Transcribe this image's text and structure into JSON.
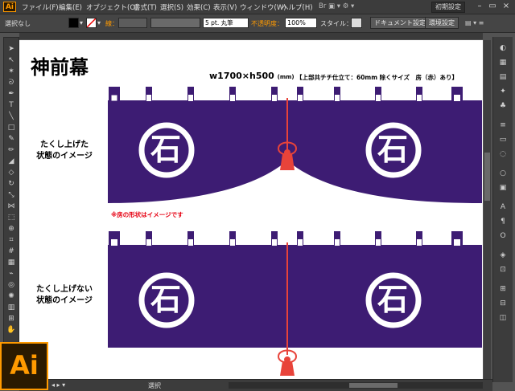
{
  "menubar": {
    "logo": "Ai",
    "items": [
      "ファイル(F)",
      "編集(E)",
      "オブジェクト(O)",
      "書式(T)",
      "選択(S)",
      "効果(C)",
      "表示(V)",
      "ウィンドウ(W)",
      "ヘルプ(H)"
    ],
    "workspace": "初期設定"
  },
  "controlbar": {
    "selection": "選択なし",
    "stroke_label": "線：",
    "brush": "5 pt. 丸筆",
    "opacity_label": "不透明度：",
    "opacity_value": "100%",
    "style_label": "スタイル：",
    "doc_settings": "ドキュメント設定",
    "preferences": "環境設定"
  },
  "document": {
    "title": "神前幕",
    "dimension_main": "w1700×h500",
    "dimension_unit": "(mm)",
    "spec": "【上部共チチ仕立て：60mm 除くサイズ　房（赤）あり】",
    "label_top_1": "たくし上げた",
    "label_top_2": "状態のイメージ",
    "note": "※房の形状はイメージです",
    "label_bottom_1": "たくし上げない",
    "label_bottom_2": "状態のイメージ",
    "crest_char": "石"
  },
  "status": {
    "tool": "選択"
  },
  "colors": {
    "curtain": "#3d1c73",
    "tassel": "#e8433a",
    "app_accent": "#ff9a00"
  }
}
